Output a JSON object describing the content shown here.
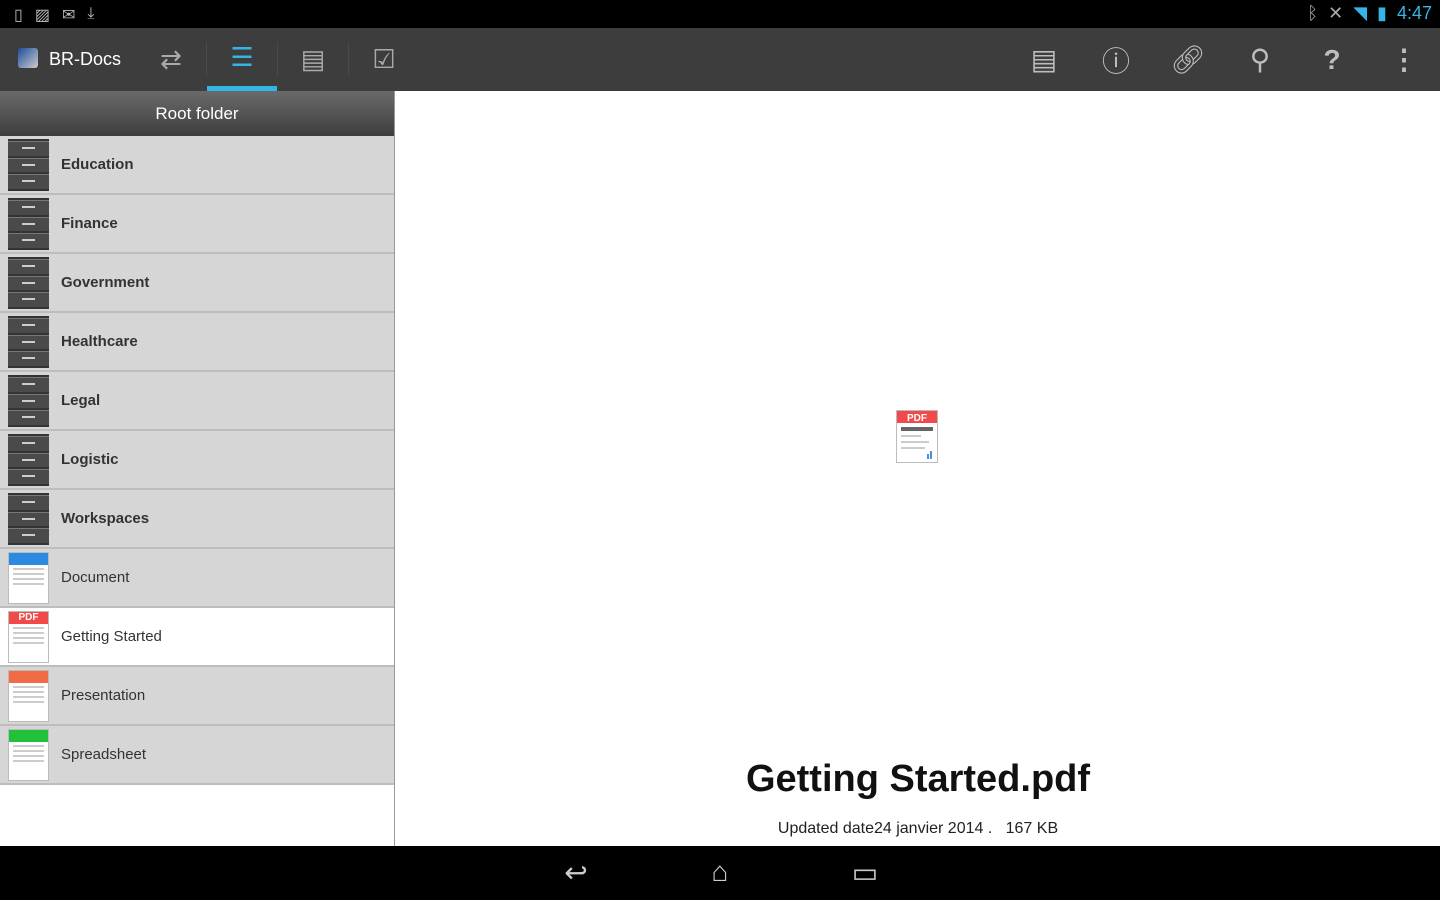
{
  "status_bar": {
    "time": "4:47",
    "left_icons": [
      "sd-card-icon",
      "image-icon",
      "gmail-icon",
      "download-icon"
    ],
    "right_icons": [
      "bluetooth-icon",
      "muted-icon",
      "wifi-icon",
      "battery-charging-icon"
    ]
  },
  "action_bar": {
    "app_title": "BR-Docs",
    "tabs": [
      "sync-icon",
      "file-cabinet-icon",
      "document-list-icon",
      "user-check-icon"
    ],
    "selected_tab": 1,
    "actions": [
      "comments-icon",
      "info-icon",
      "link-icon",
      "search-icon",
      "help-icon",
      "overflow-menu-icon"
    ]
  },
  "colors": {
    "accent": "#33b5e5",
    "action_bar": "#3d3d3d",
    "list_bg": "#d6d6d6"
  },
  "sidebar": {
    "header": "Root folder",
    "items": [
      {
        "label": "Education",
        "type": "folder"
      },
      {
        "label": "Finance",
        "type": "folder"
      },
      {
        "label": "Government",
        "type": "folder"
      },
      {
        "label": "Healthcare",
        "type": "folder"
      },
      {
        "label": "Legal",
        "type": "folder"
      },
      {
        "label": "Logistic",
        "type": "folder"
      },
      {
        "label": "Workspaces",
        "type": "folder"
      },
      {
        "label": "Document",
        "type": "doc"
      },
      {
        "label": "Getting Started",
        "type": "pdf",
        "selected": true,
        "badge": "PDF"
      },
      {
        "label": "Presentation",
        "type": "ppt"
      },
      {
        "label": "Spreadsheet",
        "type": "xls"
      }
    ]
  },
  "preview": {
    "badge": "PDF",
    "file_name": "Getting Started.pdf",
    "updated": "Updated date24 janvier 2014 .",
    "size": "167 KB"
  }
}
